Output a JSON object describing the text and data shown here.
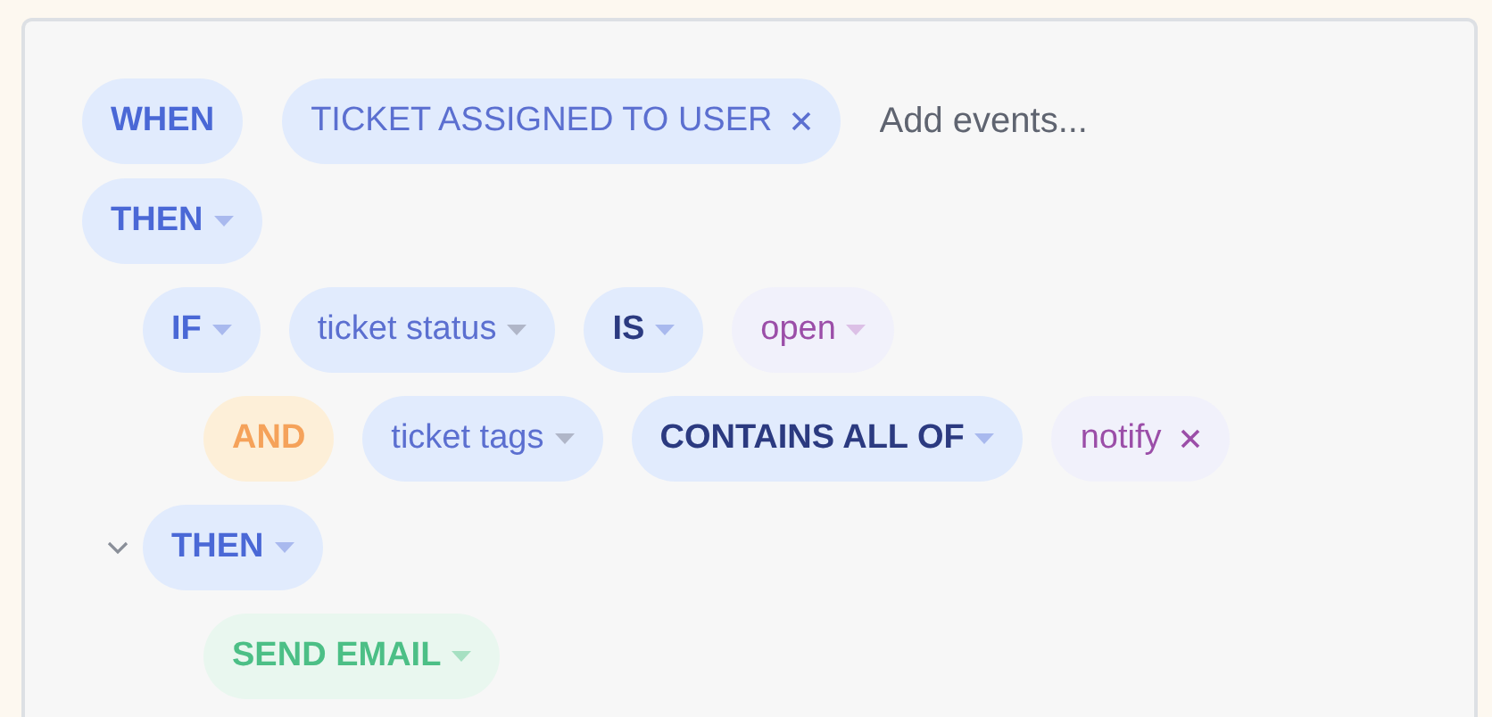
{
  "trigger": {
    "keyword": {
      "label": "WHEN",
      "kind": "keyword"
    },
    "events": [
      {
        "label": "TICKET ASSIGNED TO USER",
        "kind": "event",
        "removable": true
      }
    ],
    "placeholder": "Add events..."
  },
  "rules": [
    {
      "tokens": [
        {
          "label": "THEN",
          "kind": "keyword",
          "dropdown": true
        }
      ],
      "children": [
        {
          "tokens": [
            {
              "label": "IF",
              "kind": "keyword",
              "dropdown": true
            },
            {
              "label": "ticket status",
              "kind": "field",
              "dropdown": true
            },
            {
              "label": "IS",
              "kind": "operator",
              "dropdown": true
            },
            {
              "label": "open",
              "kind": "value",
              "dropdown": true
            }
          ],
          "children": [
            {
              "tokens": [
                {
                  "label": "AND",
                  "kind": "conjunction"
                },
                {
                  "label": "ticket tags",
                  "kind": "field",
                  "dropdown": true
                },
                {
                  "label": "CONTAINS ALL OF",
                  "kind": "operator",
                  "dropdown": true
                },
                {
                  "label": "notify",
                  "kind": "value",
                  "removable": true
                }
              ]
            }
          ]
        },
        {
          "tokens": [
            {
              "label": "THEN",
              "kind": "keyword",
              "dropdown": true
            }
          ],
          "expanded": true,
          "children": [
            {
              "tokens": [
                {
                  "label": "SEND EMAIL",
                  "kind": "action",
                  "dropdown": true
                }
              ]
            }
          ]
        }
      ]
    }
  ]
}
